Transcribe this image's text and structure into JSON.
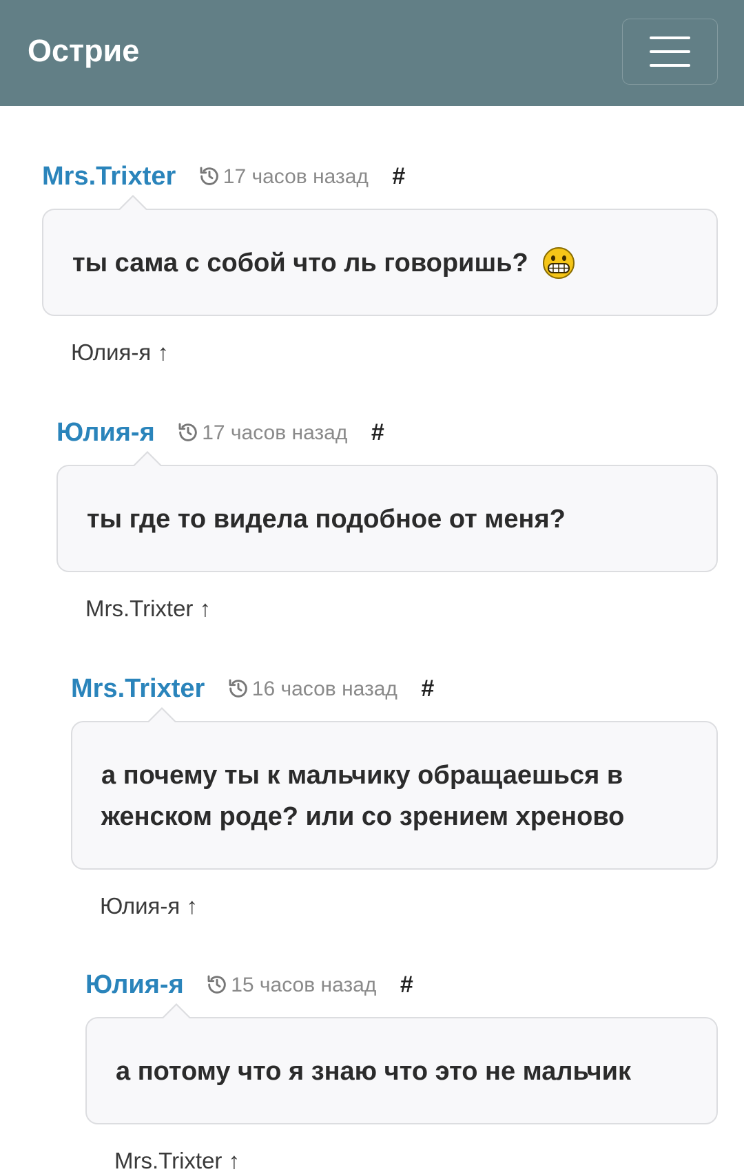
{
  "header": {
    "brand": "Острие",
    "menu_icon": "hamburger-menu-icon",
    "background_color": "#627f86"
  },
  "colors": {
    "author": "#2a84bb",
    "time": "#8a8a8a",
    "bubble_bg": "#f8f8fa"
  },
  "comments": [
    {
      "author": "Mrs.Trixter",
      "time": "17 часов назад",
      "anchor": "#",
      "text": "ты сама с собой что ль говоришь?",
      "emoji": "grinning-face-emoji",
      "reply_to": "Юлия-я ↑"
    },
    {
      "author": "Юлия-я",
      "time": "17 часов назад",
      "anchor": "#",
      "text": "ты где то видела подобное от меня?",
      "reply_to": "Mrs.Trixter ↑"
    },
    {
      "author": "Mrs.Trixter",
      "time": "16 часов назад",
      "anchor": "#",
      "text": "а почему ты к мальчику обращаешься в женском роде? или со зрением хреново",
      "reply_to": "Юлия-я ↑"
    },
    {
      "author": "Юлия-я",
      "time": "15 часов назад",
      "anchor": "#",
      "text": "а потому что я знаю что это не мальчик",
      "reply_to": "Mrs.Trixter ↑"
    }
  ]
}
